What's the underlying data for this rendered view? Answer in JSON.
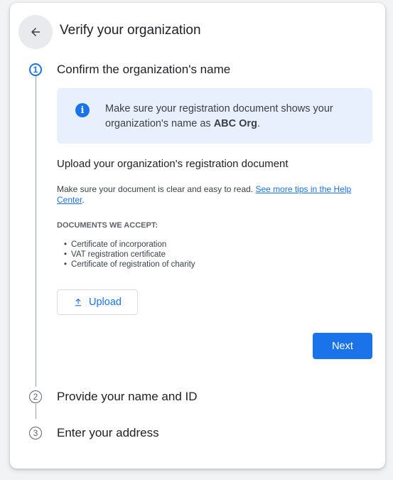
{
  "header": {
    "title": "Verify your organization"
  },
  "steps": [
    {
      "number": "1",
      "label": "Confirm the organization's name"
    },
    {
      "number": "2",
      "label": "Provide your name and ID"
    },
    {
      "number": "3",
      "label": "Enter your address"
    }
  ],
  "info": {
    "text_before": "Make sure your registration document shows your organization's name as ",
    "org_name": "ABC Org",
    "text_after": "."
  },
  "upload_section": {
    "heading": "Upload your organization's registration document",
    "description": "Make sure your document is clear and easy to read. ",
    "help_link": "See more tips in the Help Center",
    "description_end": ".",
    "docs_heading": "DOCUMENTS WE ACCEPT:",
    "docs": [
      "Certificate of incorporation",
      "VAT registration certificate",
      "Certificate of registration of charity"
    ],
    "upload_label": "Upload"
  },
  "actions": {
    "next_label": "Next"
  },
  "colors": {
    "primary": "#1a73e8",
    "info_bg": "#e8f0fe"
  },
  "icons": {
    "back": "arrow-left-icon",
    "info": "info-icon",
    "upload": "upload-icon"
  }
}
